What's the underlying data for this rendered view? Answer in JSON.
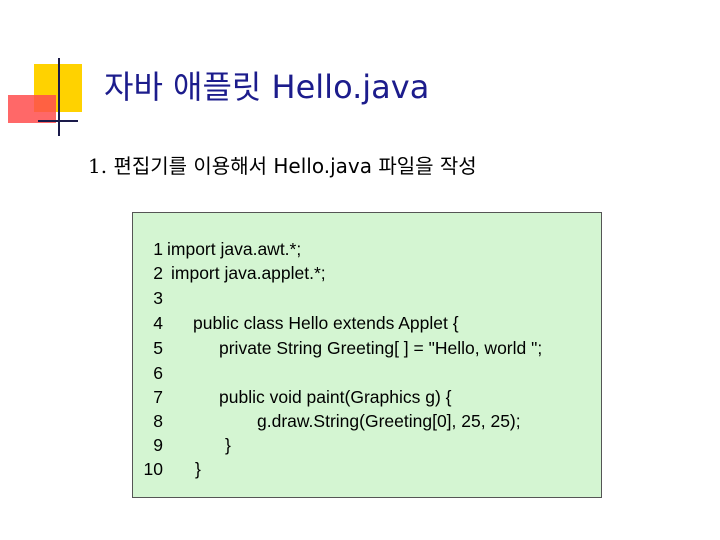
{
  "slide": {
    "title": "자바 애플릿 Hello.java",
    "subtitle_number": "1.",
    "subtitle_text": "편집기를 이용해서 Hello.java  파일을 작성"
  },
  "code": {
    "lines": [
      {
        "num": "1",
        "text": "import java.awt.*;"
      },
      {
        "num": "2",
        "text": "import java.applet.*;"
      },
      {
        "num": "3",
        "text": ""
      },
      {
        "num": "4",
        "text": "public class Hello extends Applet {"
      },
      {
        "num": "5",
        "text": "private String  Greeting[ ] =  \"Hello, world \";"
      },
      {
        "num": "6",
        "text": ""
      },
      {
        "num": "7",
        "text": "public void paint(Graphics g) {"
      },
      {
        "num": "8",
        "text": "g.draw.String(Greeting[0], 25, 25);"
      },
      {
        "num": "9",
        "text": "}"
      },
      {
        "num": "10",
        "text": "}"
      }
    ]
  },
  "colors": {
    "title": "#1c1c8c",
    "code_background": "#d4f5d2",
    "deco_yellow": "#ffd200",
    "deco_red": "#ff4d4d"
  }
}
